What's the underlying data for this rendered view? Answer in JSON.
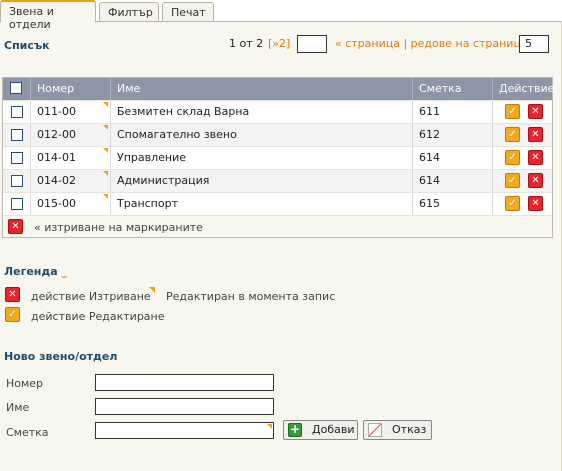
{
  "tabs": [
    "Звена и отдели",
    "Филтър",
    "Печат"
  ],
  "list": {
    "title": "Списък",
    "pager": {
      "page_of": "1 от 2",
      "next": "[»2]",
      "page_label": "« страница | редове на страница »",
      "rows_per_page": "5"
    },
    "columns": [
      "Номер",
      "Име",
      "Сметка",
      "Действие"
    ],
    "rows": [
      {
        "number": "011-00",
        "name": "Безмитен склад Варна",
        "account": "611"
      },
      {
        "number": "012-00",
        "name": "Спомагателно звено",
        "account": "612"
      },
      {
        "number": "014-01",
        "name": "Управление",
        "account": "614"
      },
      {
        "number": "014-02",
        "name": "Администрация",
        "account": "614"
      },
      {
        "number": "015-00",
        "name": "Транспорт",
        "account": "615"
      }
    ],
    "delete_marked": "« изтриване на маркираните"
  },
  "legend": {
    "title": "Легенда",
    "delete_action": "действие Изтриване",
    "edit_action": "действие Редактиране",
    "edited_now": "Редактиран в момента запис"
  },
  "new_unit": {
    "title": "Ново звено/отдел",
    "number_label": "Номер",
    "name_label": "Име",
    "account_label": "Сметка",
    "add_button": "Добави",
    "cancel_button": "Отказ"
  },
  "colors": {
    "tab_accent": "#e8a020",
    "heading": "#1f4d6b",
    "grid_header": "#8c96a6",
    "edit": "#f4a820",
    "delete": "#e8242c"
  }
}
